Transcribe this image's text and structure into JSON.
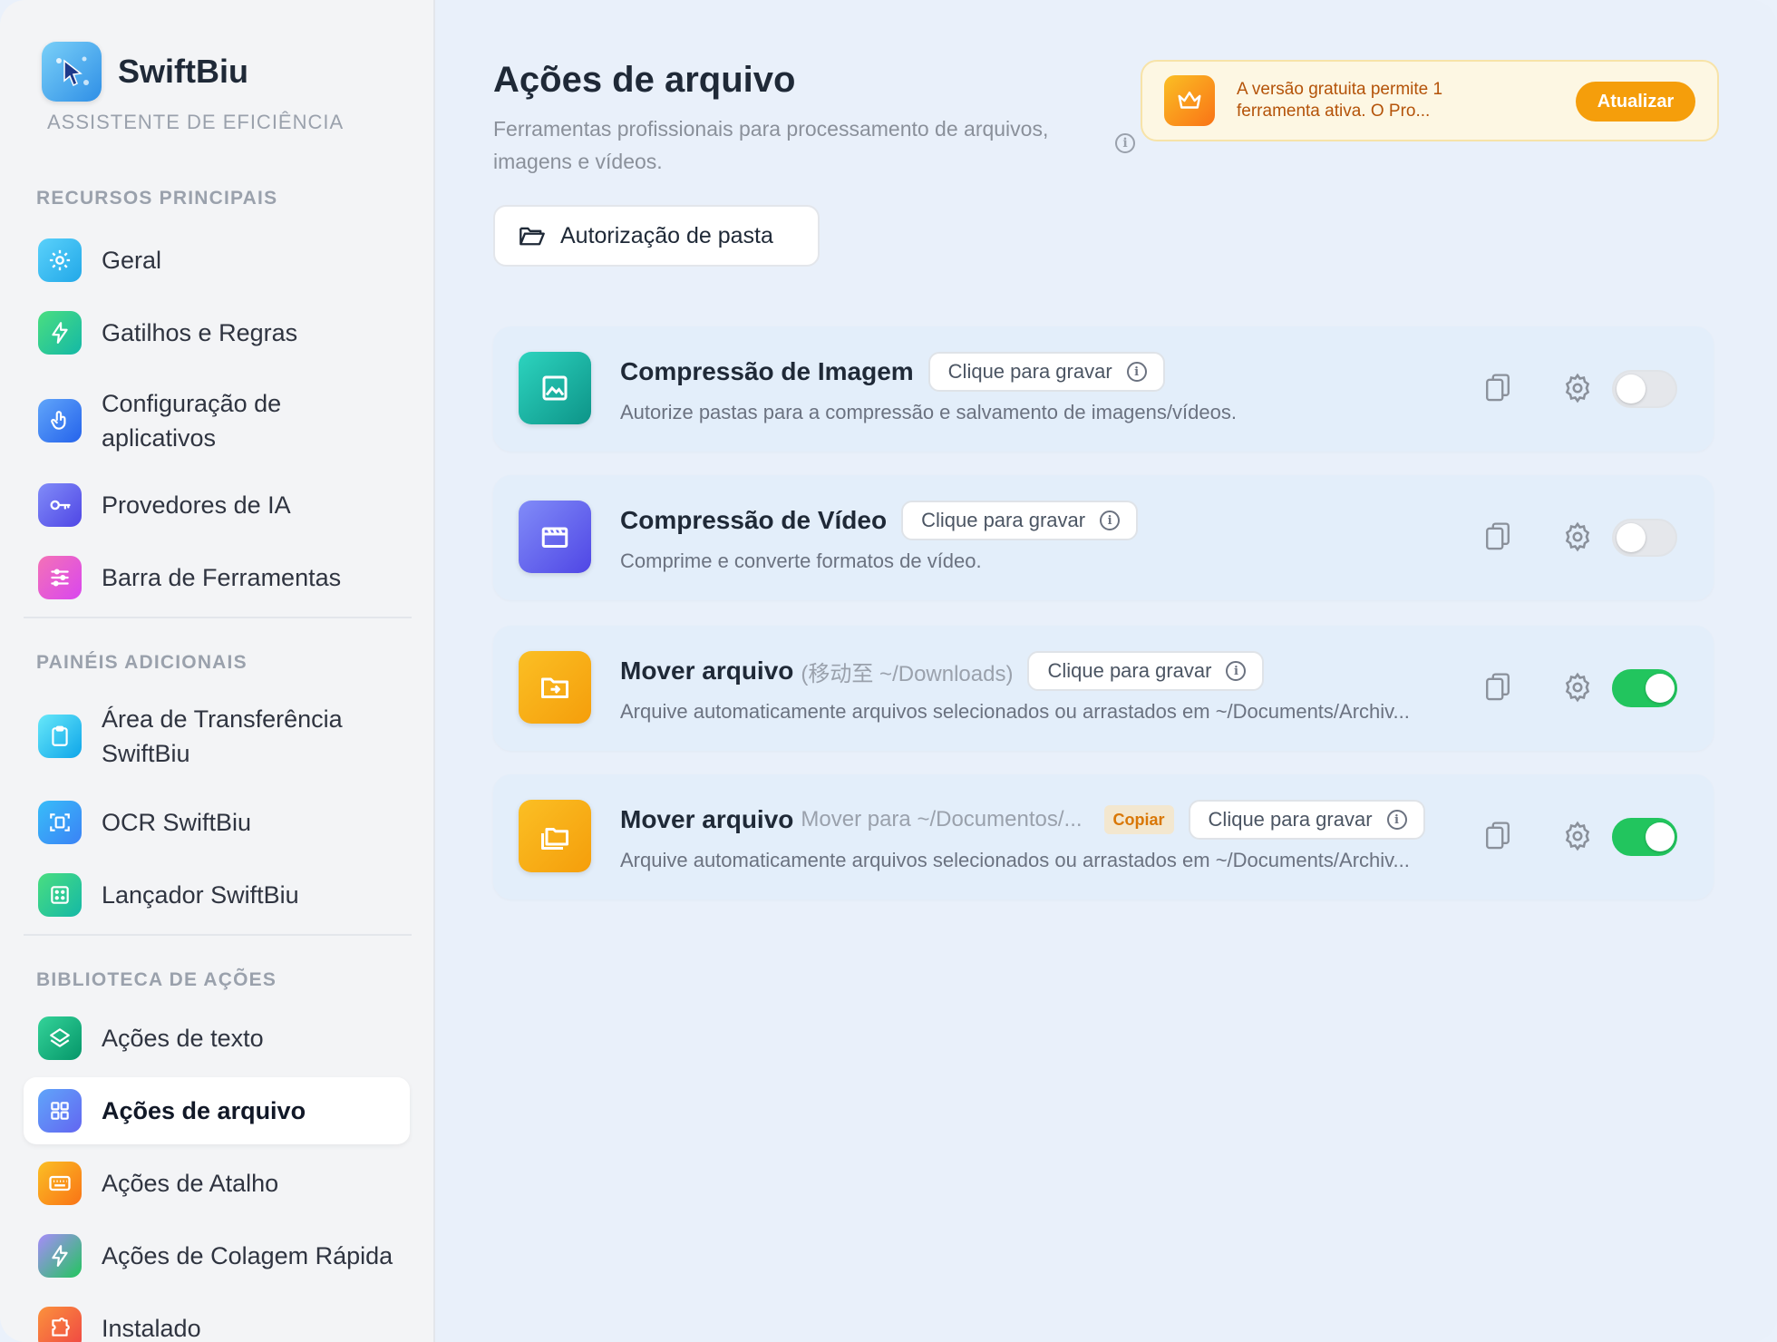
{
  "app": {
    "name": "SwiftBiu",
    "subtitle": "ASSISTENTE DE EFICIÊNCIA"
  },
  "sidebar": {
    "sections": [
      {
        "label": "RECURSOS PRINCIPAIS",
        "items": [
          {
            "label": "Geral",
            "icon": "gear-icon",
            "color": "#38bdf8"
          },
          {
            "label": "Gatilhos e Regras",
            "icon": "bolt-icon",
            "color": "#34d399"
          },
          {
            "label": "Configuração de aplicativos",
            "icon": "pointer-icon",
            "color": "#3b82f6"
          },
          {
            "label": "Provedores de IA",
            "icon": "key-icon",
            "color": "#6366f1"
          },
          {
            "label": "Barra de Ferramentas",
            "icon": "sliders-icon",
            "color": "#e879f9"
          }
        ]
      },
      {
        "label": "PAINÉIS ADICIONAIS",
        "items": [
          {
            "label": "Área de Transferência SwiftBiu",
            "icon": "clipboard-icon",
            "color": "#22d3ee"
          },
          {
            "label": "OCR SwiftBiu",
            "icon": "scan-icon",
            "color": "#38bdf8"
          },
          {
            "label": "Lançador SwiftBiu",
            "icon": "grid-dots-icon",
            "color": "#34d399"
          }
        ]
      },
      {
        "label": "BIBLIOTECA DE AÇÕES",
        "items": [
          {
            "label": "Ações de texto",
            "icon": "layers-icon",
            "color": "#10b981"
          },
          {
            "label": "Ações de arquivo",
            "icon": "grid-icon",
            "color": "#6366f1",
            "active": true
          },
          {
            "label": "Ações de Atalho",
            "icon": "keyboard-icon",
            "color": "#f97316"
          },
          {
            "label": "Ações de Colagem Rápida",
            "icon": "bolt-icon",
            "color": "#8b5cf6"
          },
          {
            "label": "Instalado",
            "icon": "puzzle-icon",
            "color": "#f97316"
          }
        ]
      }
    ]
  },
  "main": {
    "title": "Ações de arquivo",
    "description": "Ferramentas profissionais para processamento de arquivos, imagens e vídeos.",
    "banner": {
      "text": "A versão gratuita permite 1 ferramenta ativa. O Pro...",
      "button": "Atualizar"
    },
    "folder_button": "Autorização de pasta",
    "record_label": "Clique para gravar",
    "cards": [
      {
        "title": "Compressão de Imagem",
        "subtitle": "",
        "tag": "",
        "description": "Autorize pastas para a compressão e salvamento de imagens/vídeos.",
        "icon": "image-icon",
        "enabled": false
      },
      {
        "title": "Compressão de Vídeo",
        "subtitle": "",
        "tag": "",
        "description": "Comprime e converte formatos de vídeo.",
        "icon": "video-icon",
        "enabled": false
      },
      {
        "title": "Mover arquivo",
        "subtitle": "(移动至 ~/Downloads)",
        "tag": "",
        "description": "Arquive automaticamente arquivos selecionados ou arrastados em ~/Documents/Archiv...",
        "icon": "folder-move-icon",
        "enabled": true
      },
      {
        "title": "Mover arquivo",
        "subtitle": "Mover para ~/Documentos/...",
        "tag": "Copiar",
        "description": "Arquive automaticamente arquivos selecionados ou arrastados em ~/Documents/Archiv...",
        "icon": "folders-icon",
        "enabled": true
      }
    ]
  }
}
